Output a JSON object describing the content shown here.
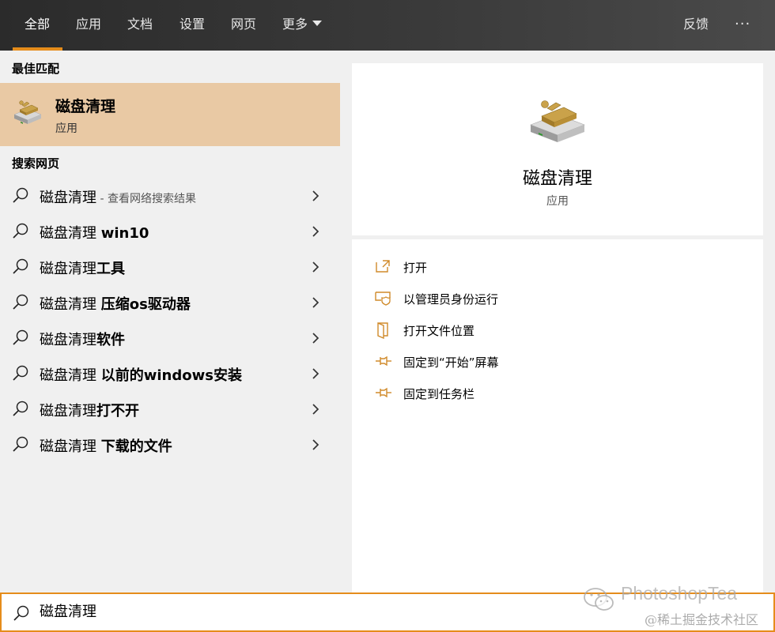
{
  "tabs": [
    "全部",
    "应用",
    "文档",
    "设置",
    "网页",
    "更多"
  ],
  "feedback": "反馈",
  "more_dots": "···",
  "best_match": {
    "header": "最佳匹配",
    "name": "磁盘清理",
    "type": "应用"
  },
  "web_search": {
    "header": "搜索网页",
    "items": [
      {
        "prefix": "磁盘清理",
        "suffix": "",
        "sub": " - 查看网络搜索结果"
      },
      {
        "prefix": "磁盘清理 ",
        "suffix": "win10",
        "sub": ""
      },
      {
        "prefix": "磁盘清理",
        "suffix": "工具",
        "sub": ""
      },
      {
        "prefix": "磁盘清理 ",
        "suffix": "压缩os驱动器",
        "sub": ""
      },
      {
        "prefix": "磁盘清理",
        "suffix": "软件",
        "sub": ""
      },
      {
        "prefix": "磁盘清理 ",
        "suffix": "以前的windows安装",
        "sub": ""
      },
      {
        "prefix": "磁盘清理",
        "suffix": "打不开",
        "sub": ""
      },
      {
        "prefix": "磁盘清理 ",
        "suffix": "下载的文件",
        "sub": ""
      }
    ]
  },
  "preview": {
    "name": "磁盘清理",
    "type": "应用"
  },
  "actions": [
    "打开",
    "以管理员身份运行",
    "打开文件位置",
    "固定到“开始”屏幕",
    "固定到任务栏"
  ],
  "search_value": "磁盘清理",
  "watermark": {
    "title": "PhotoshopTea",
    "sub": "@稀土掘金技术社区"
  },
  "colors": {
    "accent": "#e58c1b",
    "selected_bg": "#e9c9a4",
    "topbar": "#2b2b2b"
  }
}
